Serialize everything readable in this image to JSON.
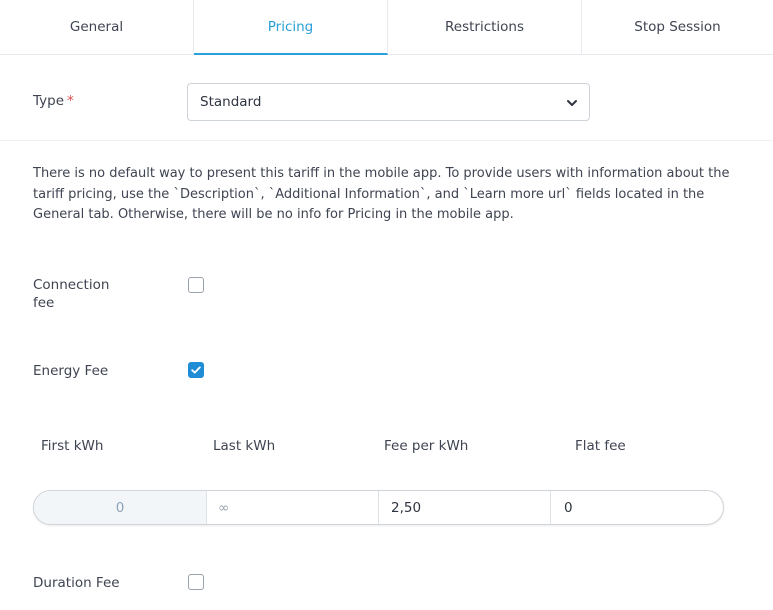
{
  "tabs": [
    {
      "label": "General",
      "active": false
    },
    {
      "label": "Pricing",
      "active": true
    },
    {
      "label": "Restrictions",
      "active": false
    },
    {
      "label": "Stop Session",
      "active": false
    }
  ],
  "type_field": {
    "label": "Type",
    "required_mark": "*",
    "selected": "Standard",
    "icon": "chevron-down-icon"
  },
  "info_text": "There is no default way to present this tariff in the mobile app. To provide users with information about the tariff pricing, use the `Description`, `Additional Information`, and `Learn more url` fields located in the General tab. Otherwise, there will be no info for Pricing in the mobile app.",
  "connection_fee": {
    "label": "Connection fee",
    "checked": false
  },
  "energy_fee": {
    "label": "Energy Fee",
    "checked": true
  },
  "energy_table": {
    "headers": [
      "First kWh",
      "Last kWh",
      "Fee per kWh",
      "Flat fee"
    ],
    "row": {
      "first_kwh": "0",
      "last_kwh_placeholder": "∞",
      "fee_per_kwh": "2,50",
      "flat_fee": "0"
    }
  },
  "duration_fee": {
    "label": "Duration Fee",
    "checked": false
  },
  "colors": {
    "accent": "#2a9fd8",
    "checkbox_checked": "#1f8dd6",
    "required": "#e14b4b"
  }
}
